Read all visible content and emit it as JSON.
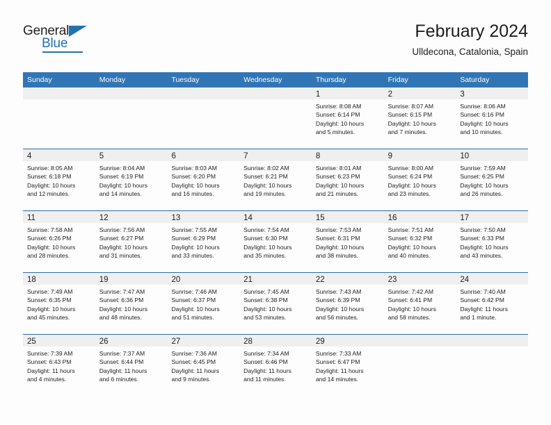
{
  "brand": {
    "name_top": "General",
    "name_bottom": "Blue",
    "accent_color": "#2271b3"
  },
  "header": {
    "title": "February 2024",
    "subtitle": "Ulldecona, Catalonia, Spain"
  },
  "colors": {
    "header_blue": "#3275b5",
    "row_divider_blue": "#2b6ca8",
    "daynum_band": "#efefef",
    "text": "#1d1d1d"
  },
  "weekdays": [
    "Sunday",
    "Monday",
    "Tuesday",
    "Wednesday",
    "Thursday",
    "Friday",
    "Saturday"
  ],
  "calendar": {
    "month": "February",
    "year": "2024",
    "weeks": [
      [
        {
          "day": "",
          "lines": []
        },
        {
          "day": "",
          "lines": []
        },
        {
          "day": "",
          "lines": []
        },
        {
          "day": "",
          "lines": []
        },
        {
          "day": "1",
          "lines": [
            "Sunrise: 8:08 AM",
            "Sunset: 6:14 PM",
            "Daylight: 10 hours",
            "and 5 minutes."
          ]
        },
        {
          "day": "2",
          "lines": [
            "Sunrise: 8:07 AM",
            "Sunset: 6:15 PM",
            "Daylight: 10 hours",
            "and 7 minutes."
          ]
        },
        {
          "day": "3",
          "lines": [
            "Sunrise: 8:06 AM",
            "Sunset: 6:16 PM",
            "Daylight: 10 hours",
            "and 10 minutes."
          ]
        }
      ],
      [
        {
          "day": "4",
          "lines": [
            "Sunrise: 8:05 AM",
            "Sunset: 6:18 PM",
            "Daylight: 10 hours",
            "and 12 minutes."
          ]
        },
        {
          "day": "5",
          "lines": [
            "Sunrise: 8:04 AM",
            "Sunset: 6:19 PM",
            "Daylight: 10 hours",
            "and 14 minutes."
          ]
        },
        {
          "day": "6",
          "lines": [
            "Sunrise: 8:03 AM",
            "Sunset: 6:20 PM",
            "Daylight: 10 hours",
            "and 16 minutes."
          ]
        },
        {
          "day": "7",
          "lines": [
            "Sunrise: 8:02 AM",
            "Sunset: 6:21 PM",
            "Daylight: 10 hours",
            "and 19 minutes."
          ]
        },
        {
          "day": "8",
          "lines": [
            "Sunrise: 8:01 AM",
            "Sunset: 6:23 PM",
            "Daylight: 10 hours",
            "and 21 minutes."
          ]
        },
        {
          "day": "9",
          "lines": [
            "Sunrise: 8:00 AM",
            "Sunset: 6:24 PM",
            "Daylight: 10 hours",
            "and 23 minutes."
          ]
        },
        {
          "day": "10",
          "lines": [
            "Sunrise: 7:59 AM",
            "Sunset: 6:25 PM",
            "Daylight: 10 hours",
            "and 26 minutes."
          ]
        }
      ],
      [
        {
          "day": "11",
          "lines": [
            "Sunrise: 7:58 AM",
            "Sunset: 6:26 PM",
            "Daylight: 10 hours",
            "and 28 minutes."
          ]
        },
        {
          "day": "12",
          "lines": [
            "Sunrise: 7:56 AM",
            "Sunset: 6:27 PM",
            "Daylight: 10 hours",
            "and 31 minutes."
          ]
        },
        {
          "day": "13",
          "lines": [
            "Sunrise: 7:55 AM",
            "Sunset: 6:29 PM",
            "Daylight: 10 hours",
            "and 33 minutes."
          ]
        },
        {
          "day": "14",
          "lines": [
            "Sunrise: 7:54 AM",
            "Sunset: 6:30 PM",
            "Daylight: 10 hours",
            "and 35 minutes."
          ]
        },
        {
          "day": "15",
          "lines": [
            "Sunrise: 7:53 AM",
            "Sunset: 6:31 PM",
            "Daylight: 10 hours",
            "and 38 minutes."
          ]
        },
        {
          "day": "16",
          "lines": [
            "Sunrise: 7:51 AM",
            "Sunset: 6:32 PM",
            "Daylight: 10 hours",
            "and 40 minutes."
          ]
        },
        {
          "day": "17",
          "lines": [
            "Sunrise: 7:50 AM",
            "Sunset: 6:33 PM",
            "Daylight: 10 hours",
            "and 43 minutes."
          ]
        }
      ],
      [
        {
          "day": "18",
          "lines": [
            "Sunrise: 7:49 AM",
            "Sunset: 6:35 PM",
            "Daylight: 10 hours",
            "and 45 minutes."
          ]
        },
        {
          "day": "19",
          "lines": [
            "Sunrise: 7:47 AM",
            "Sunset: 6:36 PM",
            "Daylight: 10 hours",
            "and 48 minutes."
          ]
        },
        {
          "day": "20",
          "lines": [
            "Sunrise: 7:46 AM",
            "Sunset: 6:37 PM",
            "Daylight: 10 hours",
            "and 51 minutes."
          ]
        },
        {
          "day": "21",
          "lines": [
            "Sunrise: 7:45 AM",
            "Sunset: 6:38 PM",
            "Daylight: 10 hours",
            "and 53 minutes."
          ]
        },
        {
          "day": "22",
          "lines": [
            "Sunrise: 7:43 AM",
            "Sunset: 6:39 PM",
            "Daylight: 10 hours",
            "and 56 minutes."
          ]
        },
        {
          "day": "23",
          "lines": [
            "Sunrise: 7:42 AM",
            "Sunset: 6:41 PM",
            "Daylight: 10 hours",
            "and 58 minutes."
          ]
        },
        {
          "day": "24",
          "lines": [
            "Sunrise: 7:40 AM",
            "Sunset: 6:42 PM",
            "Daylight: 11 hours",
            "and 1 minute."
          ]
        }
      ],
      [
        {
          "day": "25",
          "lines": [
            "Sunrise: 7:39 AM",
            "Sunset: 6:43 PM",
            "Daylight: 11 hours",
            "and 4 minutes."
          ]
        },
        {
          "day": "26",
          "lines": [
            "Sunrise: 7:37 AM",
            "Sunset: 6:44 PM",
            "Daylight: 11 hours",
            "and 6 minutes."
          ]
        },
        {
          "day": "27",
          "lines": [
            "Sunrise: 7:36 AM",
            "Sunset: 6:45 PM",
            "Daylight: 11 hours",
            "and 9 minutes."
          ]
        },
        {
          "day": "28",
          "lines": [
            "Sunrise: 7:34 AM",
            "Sunset: 6:46 PM",
            "Daylight: 11 hours",
            "and 11 minutes."
          ]
        },
        {
          "day": "29",
          "lines": [
            "Sunrise: 7:33 AM",
            "Sunset: 6:47 PM",
            "Daylight: 11 hours",
            "and 14 minutes."
          ]
        },
        {
          "day": "",
          "lines": []
        },
        {
          "day": "",
          "lines": []
        }
      ]
    ]
  }
}
